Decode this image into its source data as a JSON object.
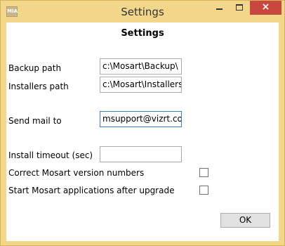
{
  "window": {
    "title": "Settings",
    "app_icon": "MIA"
  },
  "dialog": {
    "heading": "Settings"
  },
  "fields": {
    "backup_path": {
      "label": "Backup path",
      "value": "c:\\Mosart\\Backup\\"
    },
    "installers_path": {
      "label": "Installers path",
      "value": "c:\\Mosart\\Installers\\"
    },
    "send_mail_to": {
      "label": "Send mail to",
      "value": "msupport@vizrt.com"
    },
    "install_timeout": {
      "label": "Install timeout (sec)",
      "value": ""
    }
  },
  "options": {
    "correct_version": {
      "label": "Correct Mosart version numbers",
      "checked": false
    },
    "start_after_upgrade": {
      "label": "Start Mosart applications after upgrade",
      "checked": false
    }
  },
  "buttons": {
    "ok": "OK",
    "close_glyph": "×"
  },
  "icons": {
    "minimize": "minimize-icon",
    "maximize": "maximize-icon",
    "close": "close-icon"
  },
  "colors": {
    "title_bar": "#f2d68a",
    "close_button": "#c9473f",
    "focus_border": "#3c7fb1"
  }
}
